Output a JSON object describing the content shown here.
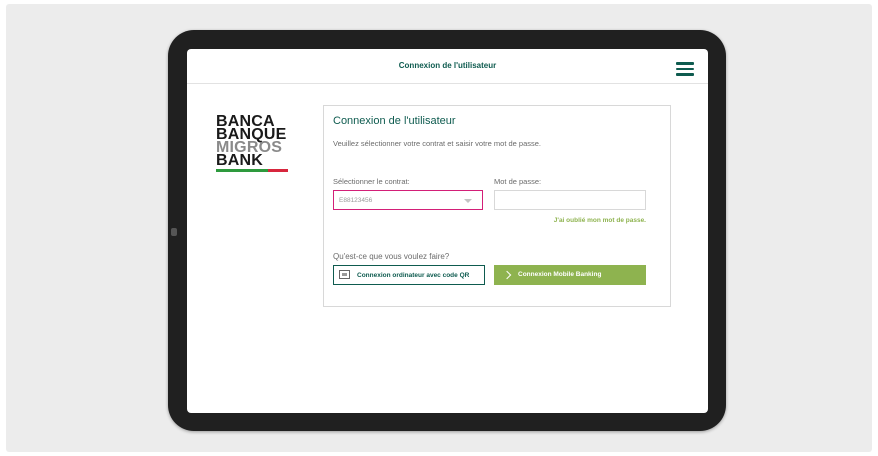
{
  "header": {
    "title": "Connexion de l'utilisateur",
    "menu_icon": "hamburger-menu-icon"
  },
  "logo": {
    "line1": "BANCA",
    "line2": "BANQUE",
    "line3": "MIGROS",
    "line4": "BANK",
    "colors": {
      "dark": "#1a1a1a",
      "grey": "#8a8a8a",
      "green": "#2e9a3e",
      "red": "#d7263d"
    }
  },
  "login": {
    "title": "Connexion de l'utilisateur",
    "description": "Veuillez sélectionner votre contrat et saisir votre mot de passe.",
    "contract_label": "Sélectionner le contrat:",
    "contract_value": "E88123456",
    "password_label": "Mot de passe:",
    "password_value": "",
    "forgot_link": "J'ai oublié mon mot de passe.",
    "action_question": "Qu'est-ce que vous voulez faire?",
    "qr_button": "Connexion ordinateur avec code QR",
    "mobile_button": "Connexion Mobile Banking"
  },
  "colors": {
    "accent": "#0e5b4f",
    "button_green": "#8eb34f",
    "focus_border": "#d31f78"
  }
}
